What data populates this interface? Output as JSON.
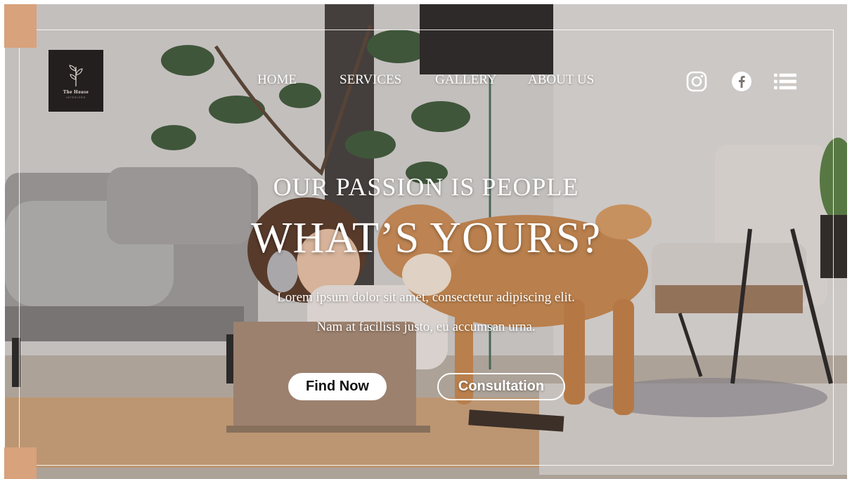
{
  "logo": {
    "brand": "The House",
    "tagline": "INTERIORS"
  },
  "nav": {
    "items": [
      "HOME",
      "SERVICES",
      "GALLERY",
      "ABOUT US"
    ]
  },
  "social": {
    "icons": [
      "instagram-icon",
      "facebook-icon",
      "menu-icon"
    ]
  },
  "hero": {
    "subtitle": "OUR PASSION IS PEOPLE",
    "title": "WHAT’S YOURS?",
    "body_line1": "Lorem ipsum dolor sit amet, consectetur adipiscing elit.",
    "body_line2": "Nam at facilisis justo, eu accumsan urna."
  },
  "buttons": {
    "primary_label": "Find Now",
    "secondary_label": "Consultation"
  },
  "colors": {
    "accent": "#d8a27c",
    "logo_bg": "#231f1f",
    "text": "#ffffff"
  }
}
